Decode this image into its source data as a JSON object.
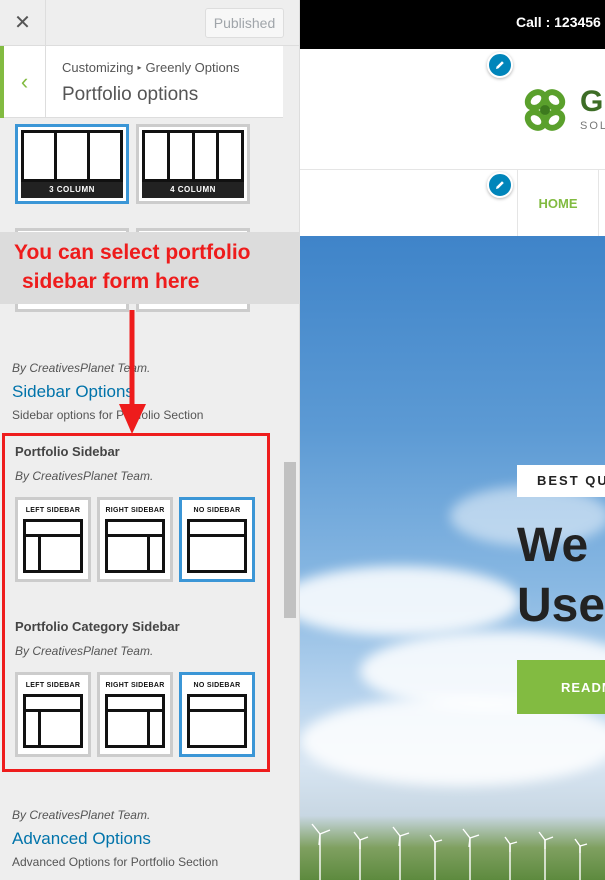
{
  "customizer": {
    "published_label": "Published",
    "breadcrumb_root": "Customizing",
    "breadcrumb_parent": "Greenly Options",
    "section_title": "Portfolio options",
    "layout_options": [
      "3 COLUMN",
      "4 COLUMN"
    ],
    "annotation_line1": "You can select portfolio",
    "annotation_line2": "sidebar form here",
    "sidebar_options": {
      "meta": "By CreativesPlanet Team.",
      "title": "Sidebar Options",
      "description": "Sidebar options for Portfolio Section"
    },
    "portfolio_sidebar": {
      "title": "Portfolio Sidebar",
      "meta": "By CreativesPlanet Team.",
      "choices": [
        "LEFT SIDEBAR",
        "RIGHT SIDEBAR",
        "NO SIDEBAR"
      ],
      "selected": "NO SIDEBAR"
    },
    "portfolio_category_sidebar": {
      "title": "Portfolio Category Sidebar",
      "meta": "By CreativesPlanet Team.",
      "choices": [
        "LEFT SIDEBAR",
        "RIGHT SIDEBAR",
        "NO SIDEBAR"
      ],
      "selected": "NO SIDEBAR"
    },
    "advanced_options": {
      "meta": "By CreativesPlanet Team.",
      "title": "Advanced Options",
      "description": "Advanced Options for Portfolio Section"
    }
  },
  "preview": {
    "call_text": "Call : 123456",
    "logo_name": "Gr",
    "logo_sub": "SOL",
    "nav_home": "HOME",
    "hero_badge": "BEST QU",
    "hero_title_1": "We",
    "hero_title_2": "Use",
    "hero_button": "READM"
  },
  "colors": {
    "accent_green": "#82bb41",
    "link_blue": "#0073aa",
    "select_blue": "#3b96d6",
    "annotation_red": "#ee1c1c"
  }
}
